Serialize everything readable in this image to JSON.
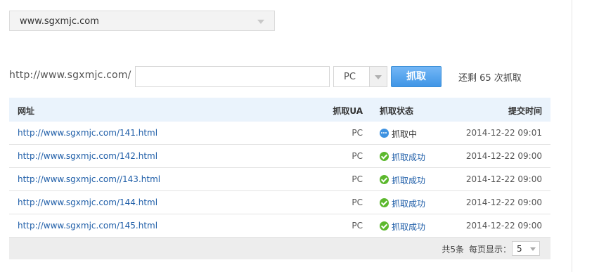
{
  "site_select": {
    "value": "www.sgxmjc.com"
  },
  "fetch_bar": {
    "prefix": "http://www.sgxmjc.com/",
    "url_value": "",
    "ua_value": "PC",
    "fetch_label": "抓取",
    "remaining": "还剩 65 次抓取"
  },
  "table": {
    "headers": {
      "url": "网址",
      "ua": "抓取UA",
      "status": "抓取状态",
      "time": "提交时间"
    },
    "rows": [
      {
        "url": "http://www.sgxmjc.com/141.html",
        "ua": "PC",
        "status": "抓取中",
        "status_type": "pending",
        "time": "2014-12-22 09:01"
      },
      {
        "url": "http://www.sgxmjc.com/142.html",
        "ua": "PC",
        "status": "抓取成功",
        "status_type": "success",
        "time": "2014-12-22 09:00"
      },
      {
        "url": "http://www.sgxmjc.com//143.html",
        "ua": "PC",
        "status": "抓取成功",
        "status_type": "success",
        "time": "2014-12-22 09:00"
      },
      {
        "url": "http://www.sgxmjc.com/144.html",
        "ua": "PC",
        "status": "抓取成功",
        "status_type": "success",
        "time": "2014-12-22 09:00"
      },
      {
        "url": "http://www.sgxmjc.com/145.html",
        "ua": "PC",
        "status": "抓取成功",
        "status_type": "success",
        "time": "2014-12-22 09:00"
      }
    ]
  },
  "pager": {
    "total": "共5条",
    "per_page_label": "每页显示：",
    "per_page_value": "5"
  },
  "colors": {
    "accent": "#3f95e6",
    "link": "#1f5ea8",
    "success": "#5cb82d",
    "header_bg": "#eaf3fc"
  }
}
